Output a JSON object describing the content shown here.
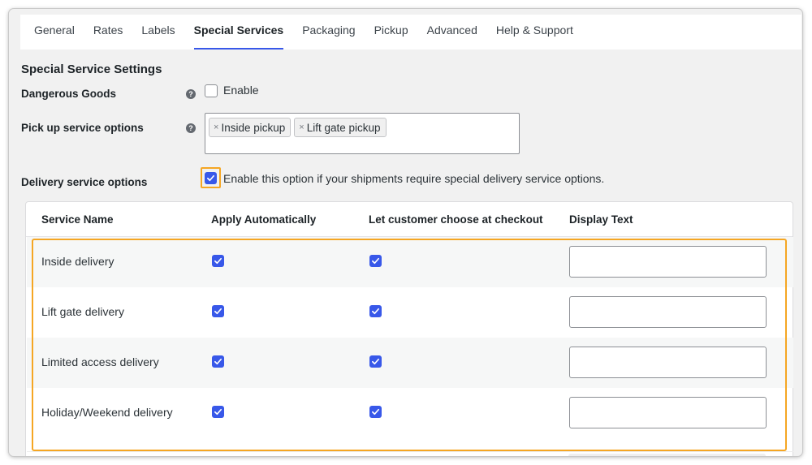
{
  "tabs": [
    {
      "label": "General",
      "active": false
    },
    {
      "label": "Rates",
      "active": false
    },
    {
      "label": "Labels",
      "active": false
    },
    {
      "label": "Special Services",
      "active": true
    },
    {
      "label": "Packaging",
      "active": false
    },
    {
      "label": "Pickup",
      "active": false
    },
    {
      "label": "Advanced",
      "active": false
    },
    {
      "label": "Help & Support",
      "active": false
    }
  ],
  "settings": {
    "title": "Special Service Settings",
    "dangerous_goods": {
      "label": "Dangerous Goods",
      "checkbox_label": "Enable",
      "checked": false,
      "help_icon": "question-mark-icon"
    },
    "pickup": {
      "label": "Pick up service options",
      "help_icon": "question-mark-icon",
      "tags": [
        "Inside pickup",
        "Lift gate pickup"
      ]
    },
    "delivery": {
      "label": "Delivery service options",
      "checked": true,
      "description": "Enable this option if your shipments require special delivery service options."
    }
  },
  "table": {
    "headers": [
      "Service Name",
      "Apply Automatically",
      "Let customer choose at checkout",
      "Display Text"
    ],
    "rows": [
      {
        "name": "Inside delivery",
        "apply": true,
        "choose": true,
        "display_text": ""
      },
      {
        "name": "Lift gate delivery",
        "apply": true,
        "choose": true,
        "display_text": ""
      },
      {
        "name": "Limited access delivery",
        "apply": true,
        "choose": true,
        "display_text": ""
      },
      {
        "name": "Holiday/Weekend delivery",
        "apply": true,
        "choose": true,
        "display_text": ""
      }
    ]
  },
  "colors": {
    "accent": "#3858e9",
    "highlight": "#f5a623"
  }
}
